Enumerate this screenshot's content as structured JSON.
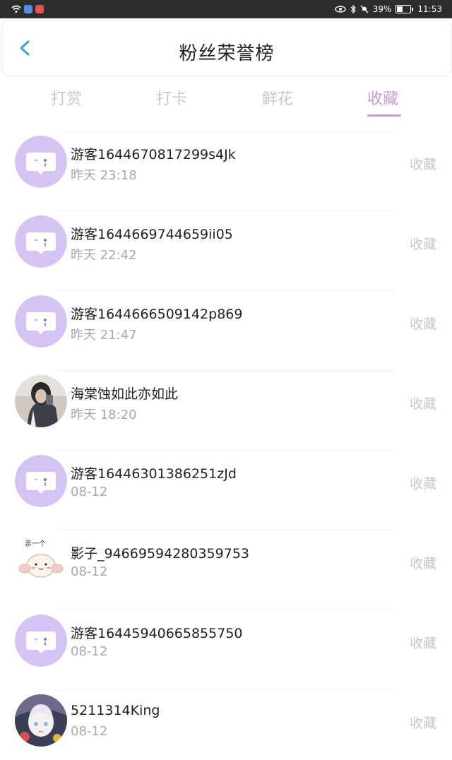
{
  "status_bar": {
    "battery": "39%",
    "time": "11:53",
    "left_icons": [
      "wifi-icon",
      "app-blue-icon",
      "app-red-icon"
    ],
    "right_icons": [
      "eye-icon",
      "bluetooth-icon",
      "mute-icon",
      "battery-icon"
    ]
  },
  "header": {
    "title": "粉丝荣誉榜",
    "back_icon": "chevron-left-icon",
    "accent_color": "#3ea1e6"
  },
  "tabs": [
    {
      "label": "打赏",
      "active": false
    },
    {
      "label": "打卡",
      "active": false
    },
    {
      "label": "鲜花",
      "active": false
    },
    {
      "label": "收藏",
      "active": true
    }
  ],
  "tab_active_color": "#c69ad6",
  "list": [
    {
      "name": "游客1644670817299s4Jk",
      "time": "昨天 23:18",
      "action": "收藏",
      "avatar": "chat-bubble-avatar"
    },
    {
      "name": "游客1644669744659ii05",
      "time": "昨天 22:42",
      "action": "收藏",
      "avatar": "chat-bubble-avatar"
    },
    {
      "name": "游客1644666509142p869",
      "time": "昨天 21:47",
      "action": "收藏",
      "avatar": "chat-bubble-avatar"
    },
    {
      "name": "海棠蚀如此亦如此",
      "time": "昨天 18:20",
      "action": "收藏",
      "avatar": "photo-avatar"
    },
    {
      "name": "游客16446301386251zJd",
      "time": "08-12",
      "action": "收藏",
      "avatar": "chat-bubble-avatar"
    },
    {
      "name": "影子_94669594280359753",
      "time": "08-12",
      "action": "收藏",
      "avatar": "cartoon-avatar"
    },
    {
      "name": "游客16445940665855750",
      "time": "08-12",
      "action": "收藏",
      "avatar": "chat-bubble-avatar"
    },
    {
      "name": "5211314King",
      "time": "08-12",
      "action": "收藏",
      "avatar": "anime-avatar"
    }
  ],
  "cartoon_avatar_text": "亲一个"
}
